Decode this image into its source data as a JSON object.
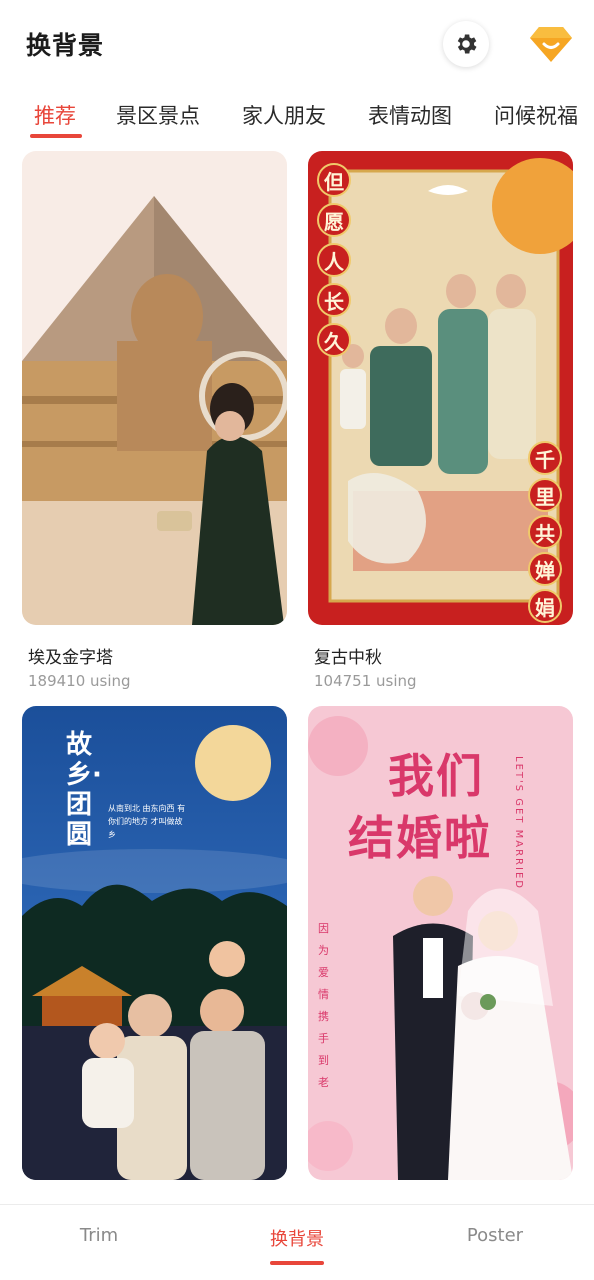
{
  "header": {
    "title": "换背景",
    "settings_icon": "gear-icon",
    "vip_icon": "diamond-icon"
  },
  "tabs": [
    {
      "label": "推荐",
      "active": true
    },
    {
      "label": "景区景点",
      "active": false
    },
    {
      "label": "家人朋友",
      "active": false
    },
    {
      "label": "表情动图",
      "active": false
    },
    {
      "label": "问候祝福",
      "active": false
    }
  ],
  "cards": [
    {
      "title": "埃及金字塔",
      "usage": "189410 using"
    },
    {
      "title": "复古中秋",
      "usage": "104751 using",
      "overlay_left": [
        "但",
        "愿",
        "人",
        "长",
        "久"
      ],
      "overlay_right": [
        "千",
        "里",
        "共",
        "婵",
        "娟"
      ]
    },
    {
      "title": "",
      "usage": "",
      "overlay_title": "故乡·团圆",
      "overlay_sub": "从南到北 由东向西 有你们的地方 才叫做故乡"
    },
    {
      "title": "",
      "usage": "",
      "overlay_title_1": "我们",
      "overlay_title_2": "结婚啦",
      "overlay_side": "LET'S GET MARRIED",
      "overlay_vertical": [
        "因",
        "为",
        "爱",
        "情",
        "携",
        "手",
        "到",
        "老"
      ]
    }
  ],
  "bottom_nav": [
    {
      "label": "Trim",
      "active": false
    },
    {
      "label": "换背景",
      "active": true
    },
    {
      "label": "Poster",
      "active": false
    }
  ],
  "colors": {
    "accent": "#e8463a",
    "muted": "#9a9a9a"
  }
}
